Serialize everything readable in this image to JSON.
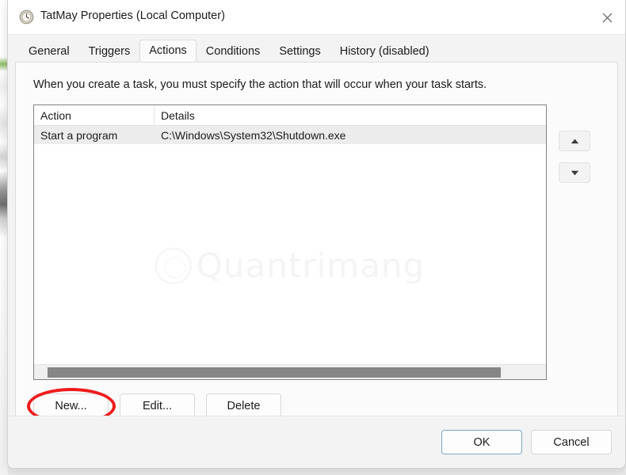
{
  "window": {
    "title": "TatMay Properties (Local Computer)",
    "icon": "clock-icon",
    "close_label": "✕"
  },
  "tabs": [
    {
      "label": "General",
      "active": false
    },
    {
      "label": "Triggers",
      "active": false
    },
    {
      "label": "Actions",
      "active": true
    },
    {
      "label": "Conditions",
      "active": false
    },
    {
      "label": "Settings",
      "active": false
    },
    {
      "label": "History (disabled)",
      "active": false
    }
  ],
  "page": {
    "description": "When you create a task, you must specify the action that will occur when your task starts.",
    "watermark": "Quantrimang"
  },
  "list": {
    "columns": [
      "Action",
      "Details"
    ],
    "rows": [
      {
        "action": "Start a program",
        "details": "C:\\Windows\\System32\\Shutdown.exe",
        "selected": true
      }
    ]
  },
  "reorder": {
    "up_label": "▲",
    "down_label": "▼"
  },
  "buttons": {
    "new": "New...",
    "edit": "Edit...",
    "delete": "Delete",
    "ok": "OK",
    "cancel": "Cancel"
  },
  "colors": {
    "annotation": "#ee1b1b",
    "dialog_bg": "#f3f3f3",
    "page_bg": "#fbfbfb",
    "selected_row": "#ececec",
    "scrollbar_thumb": "#868686",
    "default_button_border": "#7aa7c7"
  }
}
